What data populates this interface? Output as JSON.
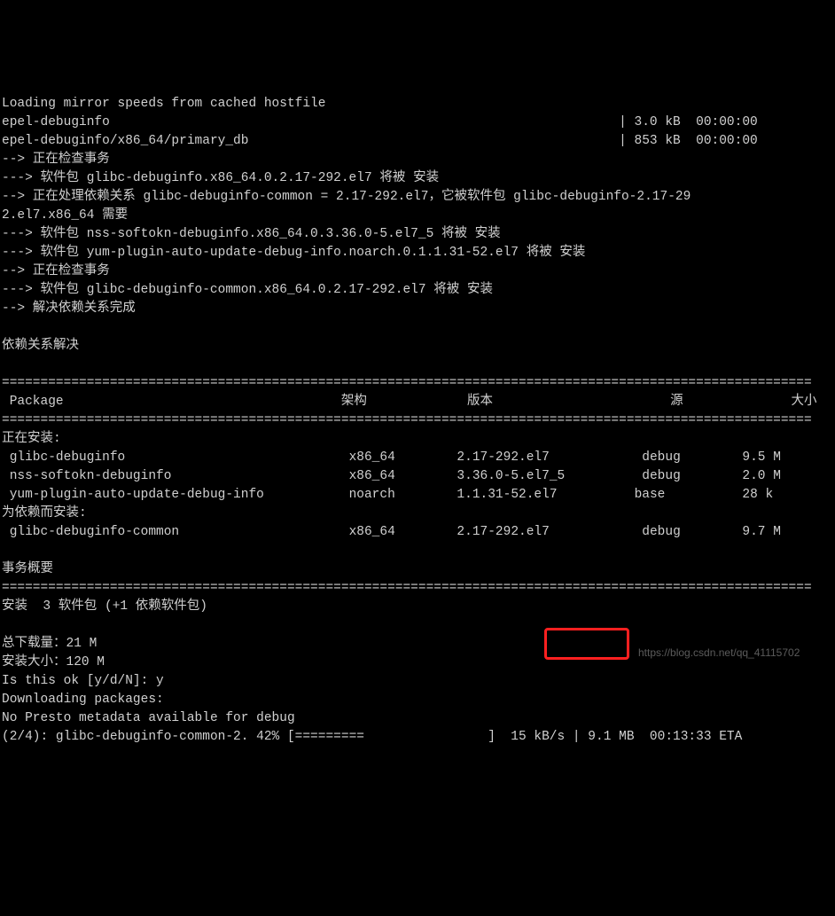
{
  "lines": {
    "l0": "Loading mirror speeds from cached hostfile",
    "l1": "epel-debuginfo                                                                  | 3.0 kB  00:00:00",
    "l2": "epel-debuginfo/x86_64/primary_db                                                | 853 kB  00:00:00",
    "l3": "--> 正在检查事务",
    "l4": "---> 软件包 glibc-debuginfo.x86_64.0.2.17-292.el7 将被 安装",
    "l5": "--> 正在处理依赖关系 glibc-debuginfo-common = 2.17-292.el7，它被软件包 glibc-debuginfo-2.17-29",
    "l6": "2.el7.x86_64 需要",
    "l7": "---> 软件包 nss-softokn-debuginfo.x86_64.0.3.36.0-5.el7_5 将被 安装",
    "l8": "---> 软件包 yum-plugin-auto-update-debug-info.noarch.0.1.1.31-52.el7 将被 安装",
    "l9": "--> 正在检查事务",
    "l10": "---> 软件包 glibc-debuginfo-common.x86_64.0.2.17-292.el7 将被 安装",
    "l11": "--> 解决依赖关系完成",
    "l12": "",
    "l13": "依赖关系解决",
    "l14": ""
  },
  "sep": "=========================================================================================================",
  "header": {
    "package": "Package",
    "arch": "架构",
    "version": "版本",
    "repo": "源",
    "size": "大小"
  },
  "install_section": "正在安装:",
  "dep_section": "为依赖而安装:",
  "packages": [
    {
      "name": "glibc-debuginfo",
      "arch": "x86_64",
      "version": "2.17-292.el7",
      "repo": "debug",
      "size": "9.5 M"
    },
    {
      "name": "nss-softokn-debuginfo",
      "arch": "x86_64",
      "version": "3.36.0-5.el7_5",
      "repo": "debug",
      "size": "2.0 M"
    },
    {
      "name": "yum-plugin-auto-update-debug-info",
      "arch": "noarch",
      "version": "1.1.31-52.el7",
      "repo": "base",
      "size": "28 k"
    }
  ],
  "dep_packages": [
    {
      "name": "glibc-debuginfo-common",
      "arch": "x86_64",
      "version": "2.17-292.el7",
      "repo": "debug",
      "size": "9.7 M"
    }
  ],
  "summary": {
    "title": "事务概要",
    "install_line": "安装  3 软件包 (+1 依赖软件包)",
    "total_dl": "总下载量：21 M",
    "install_size": "安装大小：120 M",
    "prompt": "Is this ok [y/d/N]: y",
    "downloading": "Downloading packages:",
    "presto": "No Presto metadata available for debug"
  },
  "progress": {
    "prefix": "(2/4): glibc-debuginfo-common-2. 42% [=========                ]  15 kB/s | 9.1 MB  00:13:33 ETA"
  },
  "watermark": "https://blog.csdn.net/qq_41115702"
}
